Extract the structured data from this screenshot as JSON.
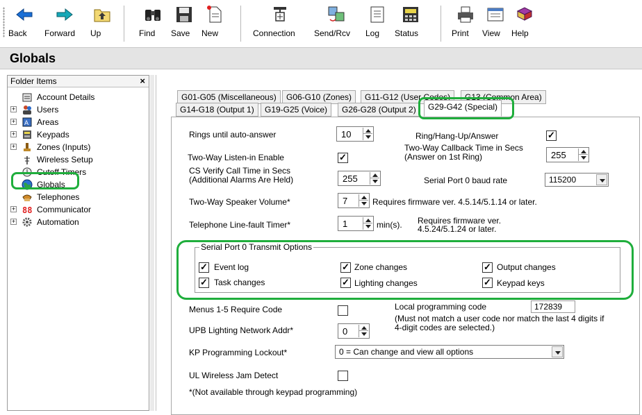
{
  "toolbar": {
    "buttons": [
      {
        "label": "Back",
        "icon": "back-arrow-icon"
      },
      {
        "label": "Forward",
        "icon": "forward-arrow-icon"
      },
      {
        "label": "Up",
        "icon": "up-folder-icon"
      },
      {
        "label": "Find",
        "icon": "binoculars-icon"
      },
      {
        "label": "Save",
        "icon": "floppy-disk-icon"
      },
      {
        "label": "New",
        "icon": "new-document-icon"
      },
      {
        "label": "Connection",
        "icon": "connection-plug-icon"
      },
      {
        "label": "Send/Rcv",
        "icon": "send-receive-icon"
      },
      {
        "label": "Log",
        "icon": "log-book-icon"
      },
      {
        "label": "Status",
        "icon": "status-panel-icon"
      },
      {
        "label": "Print",
        "icon": "printer-icon"
      },
      {
        "label": "View",
        "icon": "view-window-icon"
      },
      {
        "label": "Help",
        "icon": "help-book-icon"
      }
    ]
  },
  "title": "Globals",
  "folder_pane": {
    "header": "Folder Items",
    "close": "×",
    "items": [
      {
        "label": "Account Details",
        "icon": "notepad-icon",
        "expandable": false
      },
      {
        "label": "Users",
        "icon": "users-icon",
        "expandable": true
      },
      {
        "label": "Areas",
        "icon": "areas-icon",
        "expandable": true
      },
      {
        "label": "Keypads",
        "icon": "keypad-icon",
        "expandable": true
      },
      {
        "label": "Zones (Inputs)",
        "icon": "zones-icon",
        "expandable": true
      },
      {
        "label": "Wireless Setup",
        "icon": "wireless-antenna-icon",
        "expandable": false
      },
      {
        "label": "Cutoff Timers",
        "icon": "timer-icon",
        "expandable": false
      },
      {
        "label": "Globals",
        "icon": "globe-icon",
        "expandable": false
      },
      {
        "label": "Telephones",
        "icon": "telephone-icon",
        "expandable": false
      },
      {
        "label": "Communicator",
        "icon": "communicator-icon",
        "expandable": true
      },
      {
        "label": "Automation",
        "icon": "gear-icon",
        "expandable": true
      }
    ]
  },
  "tabs": {
    "row1": [
      "G01-G05 (Miscellaneous)",
      "G06-G10 (Zones)",
      "G11-G12 (User Codes)",
      "G13 (Common Area)"
    ],
    "row2": [
      "G14-G18 (Output 1)",
      "G19-G25 (Voice)",
      "G26-G28 (Output 2)",
      "G29-G42 (Special)"
    ],
    "active": "G29-G42 (Special)"
  },
  "form": {
    "rings_label": "Rings until auto-answer",
    "rings_value": "10",
    "ring_hangup_label": "Ring/Hang-Up/Answer",
    "ring_hangup_checked": "✓",
    "listen_in_label": "Two-Way Listen-in Enable",
    "listen_in_checked": "✓",
    "callback_label_1": "Two-Way Callback Time in Secs",
    "callback_label_2": "(Answer on 1st Ring)",
    "callback_value": "255",
    "cs_verify_label_1": "CS Verify Call Time in Secs",
    "cs_verify_label_2": "(Additional Alarms Are Held)",
    "cs_verify_value": "255",
    "baud_label": "Serial Port 0 baud rate",
    "baud_value": "115200",
    "speaker_label": "Two-Way Speaker Volume*",
    "speaker_value": "7",
    "speaker_note": "Requires firmware ver. 4.5.14/5.1.14 or later.",
    "linefault_label": "Telephone Line-fault Timer*",
    "linefault_value": "1",
    "linefault_unit": "min(s).",
    "linefault_note_1": "Requires firmware ver.",
    "linefault_note_2": "4.5.24/5.1.24 or later.",
    "serial_group_title": "Serial Port 0 Transmit Options",
    "serial_options": [
      {
        "label": "Event log",
        "checked": "✓"
      },
      {
        "label": "Zone changes",
        "checked": "✓"
      },
      {
        "label": "Output changes",
        "checked": "✓"
      },
      {
        "label": "Task changes",
        "checked": "✓"
      },
      {
        "label": "Lighting changes",
        "checked": "✓"
      },
      {
        "label": "Keypad keys",
        "checked": "✓"
      }
    ],
    "menus_label": "Menus 1-5 Require Code",
    "local_code_label": "Local programming code",
    "local_code_value": "172839",
    "local_code_note_1": "(Must not match a user code nor match the last 4 digits if",
    "local_code_note_2": "4-digit codes are selected.)",
    "upb_label": "UPB Lighting Network Addr*",
    "upb_value": "0",
    "kp_lockout_label": "KP Programming Lockout*",
    "kp_lockout_value": "0 = Can change and view all options",
    "ul_jam_label": "UL Wireless Jam Detect",
    "footnote": "*(Not available through keypad programming)"
  },
  "colors": {
    "highlight": "#1fae3c",
    "title_bg": "#e4e4e4"
  }
}
